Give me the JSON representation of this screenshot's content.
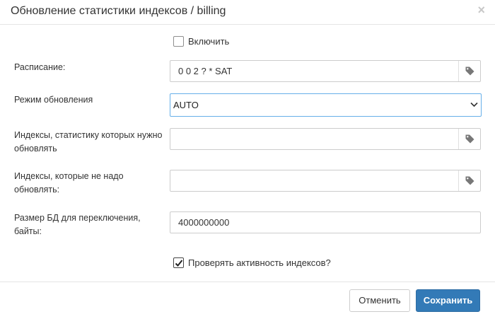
{
  "dialog": {
    "title": "Обновление статистики индексов / billing",
    "close_symbol": "×"
  },
  "enable": {
    "label": "Включить",
    "checked": false
  },
  "schedule": {
    "label": "Расписание:",
    "value": "0 0 2 ? * SAT",
    "icon": "tag-icon"
  },
  "update_mode": {
    "label": "Режим обновления",
    "selected": "AUTO"
  },
  "indexes_update": {
    "label": "Индексы, статистику которых нужно обновлять",
    "value": "",
    "icon": "tag-icon"
  },
  "indexes_skip": {
    "label": "Индексы, которые не надо обновлять:",
    "value": "",
    "icon": "tag-icon"
  },
  "db_size": {
    "label": "Размер БД для переключения, байты:",
    "value": "4000000000"
  },
  "check_activity": {
    "label": "Проверять активность индексов?",
    "checked": true
  },
  "footer": {
    "cancel_label": "Отменить",
    "save_label": "Сохранить"
  },
  "colors": {
    "primary": "#337ab7",
    "focus_border": "#66afe9"
  }
}
